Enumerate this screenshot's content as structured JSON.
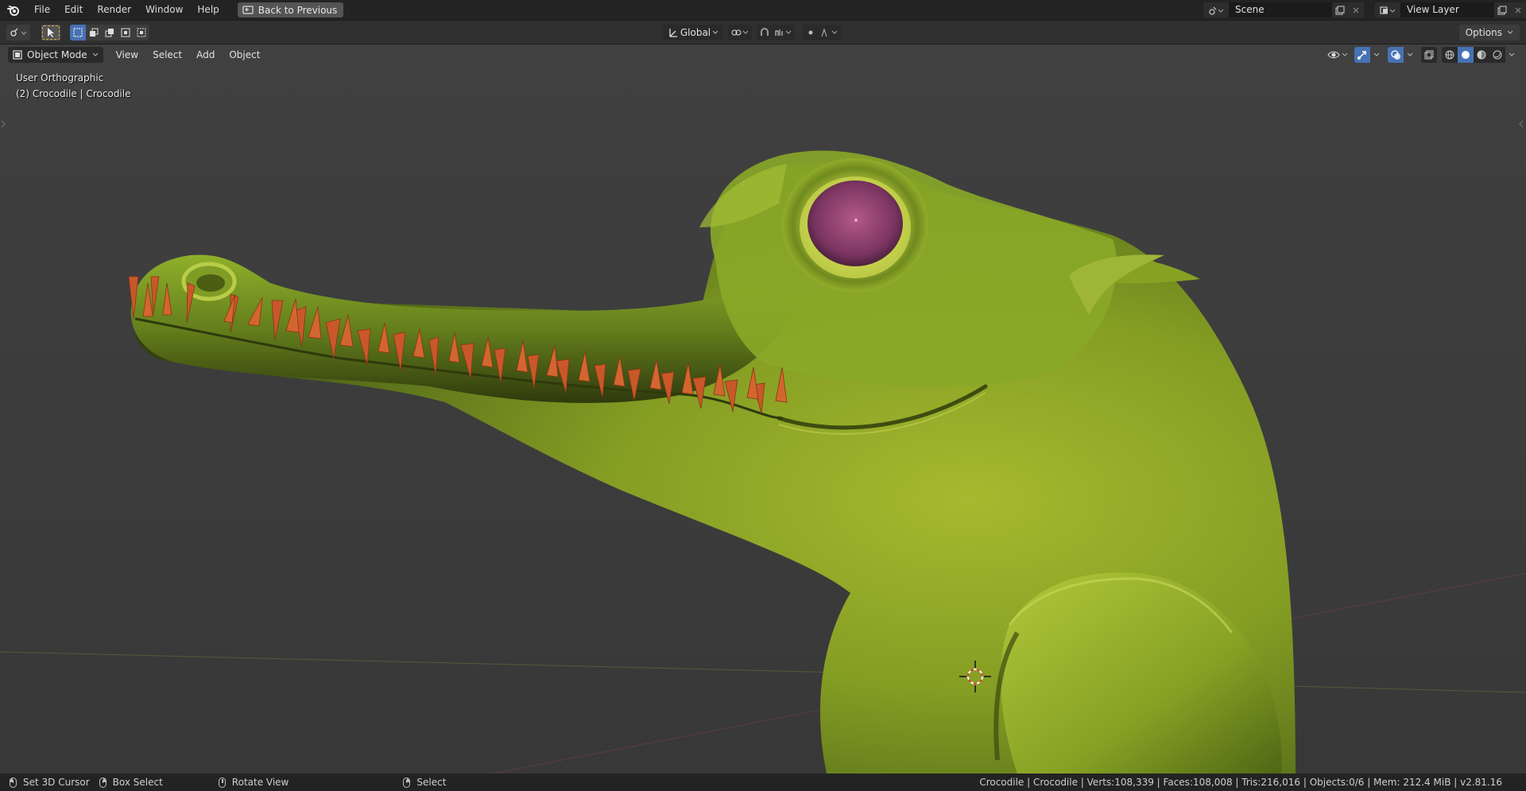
{
  "menubar": {
    "items": [
      "File",
      "Edit",
      "Render",
      "Window",
      "Help"
    ],
    "back_button_label": "Back to Previous",
    "scene_name": "Scene",
    "view_layer_name": "View Layer"
  },
  "toolbar": {
    "orientation_label": "Global",
    "options_label": "Options"
  },
  "viewport_header": {
    "mode_label": "Object Mode",
    "menus": [
      "View",
      "Select",
      "Add",
      "Object"
    ]
  },
  "viewport": {
    "view_name": "User Orthographic",
    "object_info": "(2) Crocodile | Crocodile"
  },
  "statusbar": {
    "set_cursor": "Set 3D Cursor",
    "box_select": "Box Select",
    "rotate_view": "Rotate View",
    "select": "Select",
    "stats": "Crocodile | Crocodile | Verts:108,339 | Faces:108,008 | Tris:216,016 | Objects:0/6 | Mem: 212.4 MiB | v2.81.16"
  },
  "colors": {
    "accent": "#4772b3",
    "viewport_bg": "#3d3d3d",
    "model_green": "#8aa62a",
    "teeth": "#c85a23",
    "eye": "#8e3f6e"
  },
  "icons": [
    "blender-logo-icon",
    "back-icon",
    "select-tool-icon",
    "box-select-mode-icons",
    "orientation-icon",
    "pivot-icon",
    "snap-icon",
    "proportional-icon",
    "visibility-icon",
    "gizmo-icon",
    "overlay-icon",
    "xray-icon",
    "shading-icons",
    "scene-icon",
    "view-layer-icon",
    "3d-cursor-icon"
  ]
}
